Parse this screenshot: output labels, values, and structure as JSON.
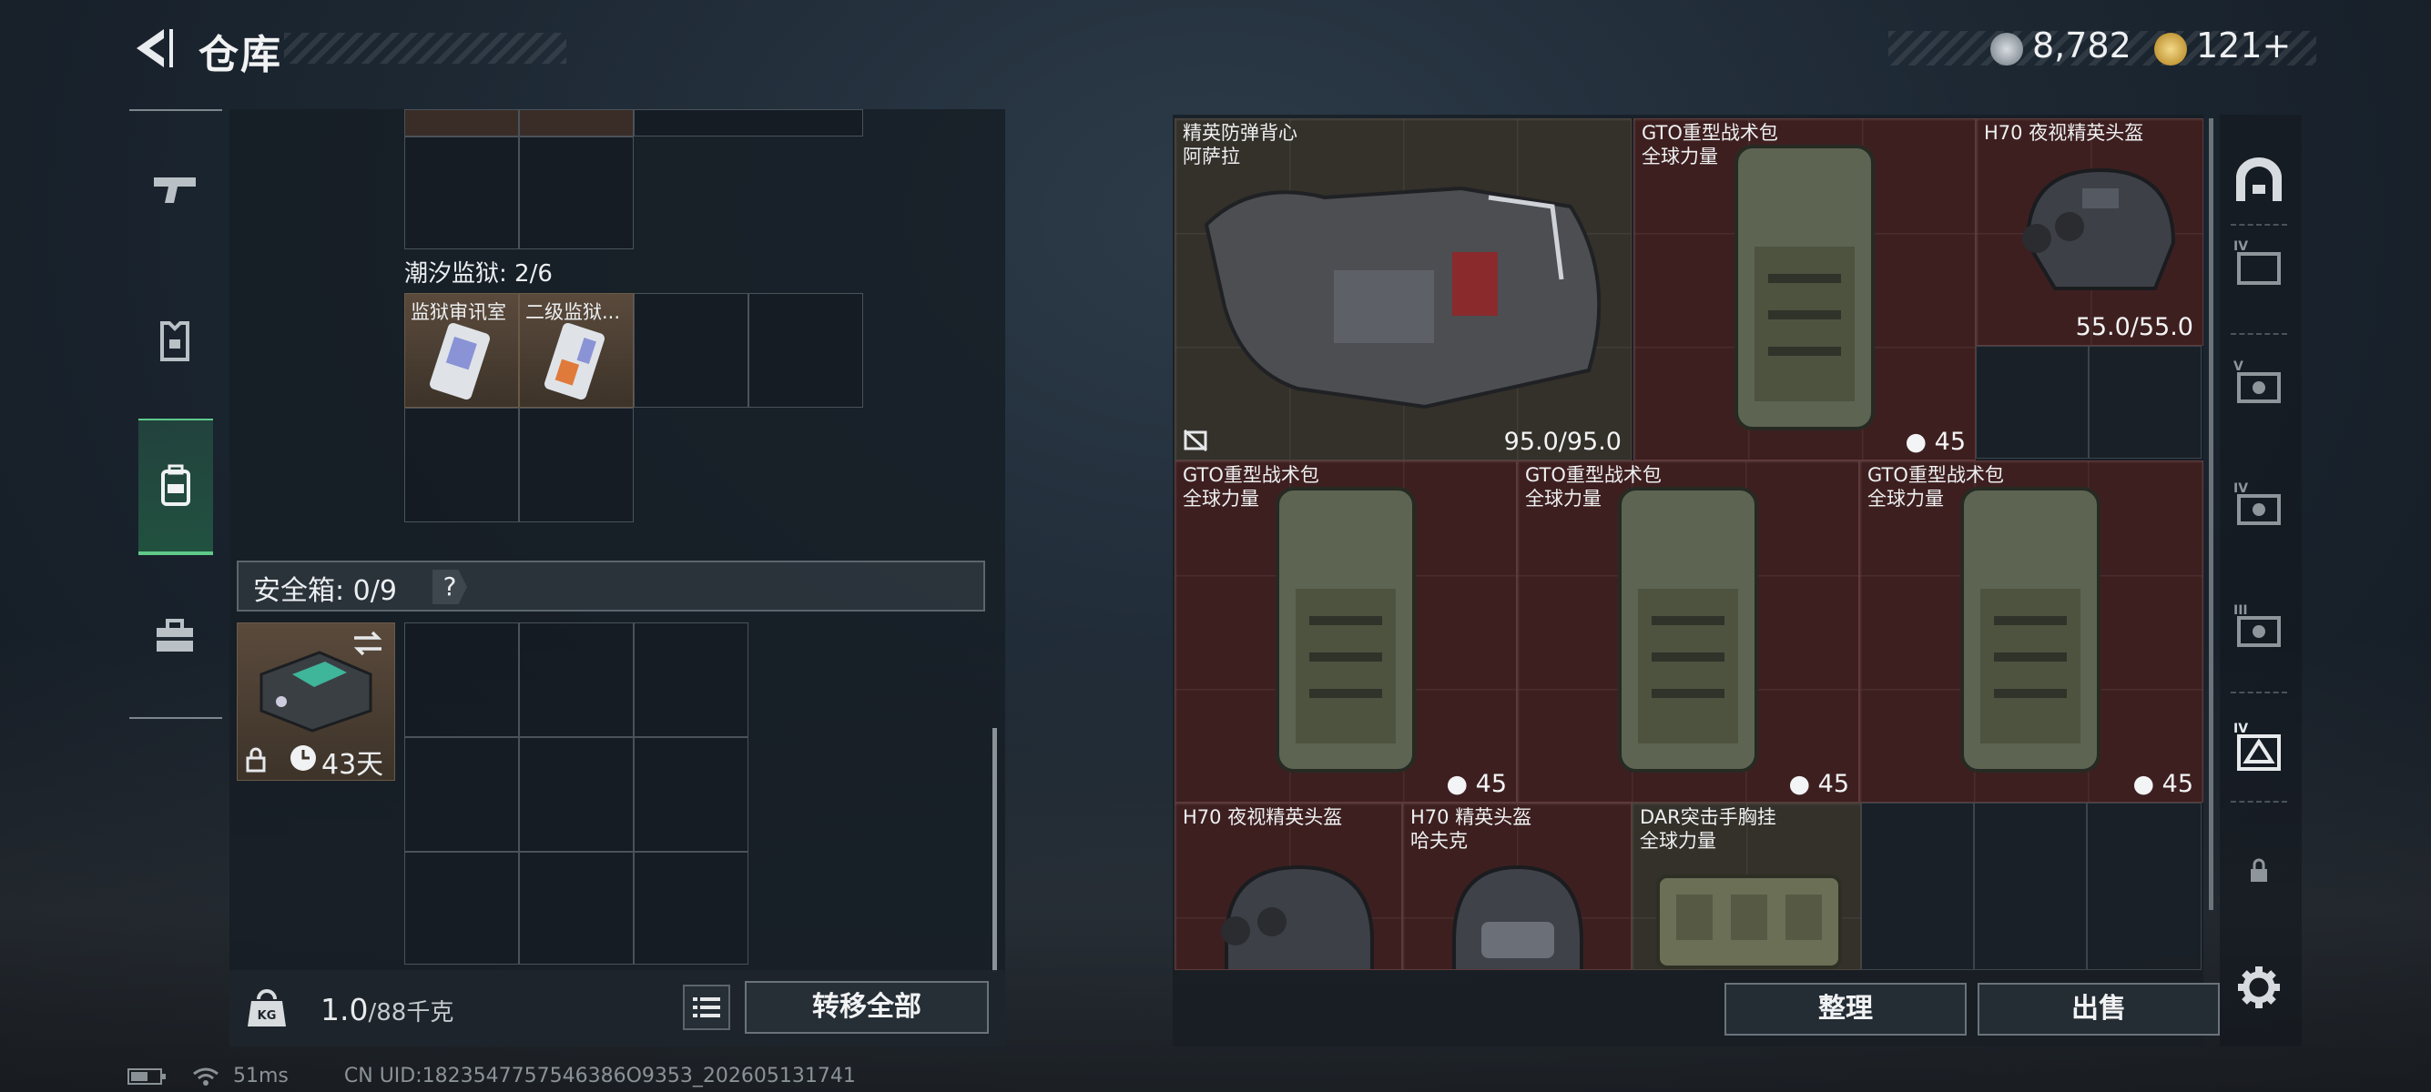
{
  "header": {
    "title": "仓库",
    "currency1": "8,782",
    "currency2": "121+"
  },
  "left": {
    "container_label": "潮汐监狱: 2/6",
    "items": [
      {
        "name": "监狱审讯室"
      },
      {
        "name": "二级监狱..."
      }
    ],
    "safebox_label": "安全箱: 0/9",
    "safebox_help": "?",
    "safebox_item": {
      "duration": "43天"
    },
    "weight": "1.0",
    "weight_unit": "/88千克",
    "transfer_all": "转移全部"
  },
  "right": {
    "items": [
      {
        "name": "精英防弹背心",
        "sub": "阿萨拉",
        "value": "95.0/95.0"
      },
      {
        "name": "GTO重型战术包",
        "sub": "全球力量",
        "value": "45"
      },
      {
        "name": "H70 夜视精英头盔",
        "sub": "",
        "value": "55.0/55.0"
      },
      {
        "name": "GTO重型战术包",
        "sub": "全球力量",
        "value": "45"
      },
      {
        "name": "GTO重型战术包",
        "sub": "全球力量",
        "value": "45"
      },
      {
        "name": "GTO重型战术包",
        "sub": "全球力量",
        "value": "45"
      },
      {
        "name": "H70 夜视精英头盔",
        "sub": ""
      },
      {
        "name": "H70 精英头盔",
        "sub": "哈夫克"
      },
      {
        "name": "DAR突击手胸挂",
        "sub": "全球力量"
      }
    ],
    "sort_button": "整理",
    "sell_button": "出售"
  },
  "footer": {
    "ping": "51ms",
    "uid": "CN UID:1823547757546386O9353_202605131741"
  }
}
